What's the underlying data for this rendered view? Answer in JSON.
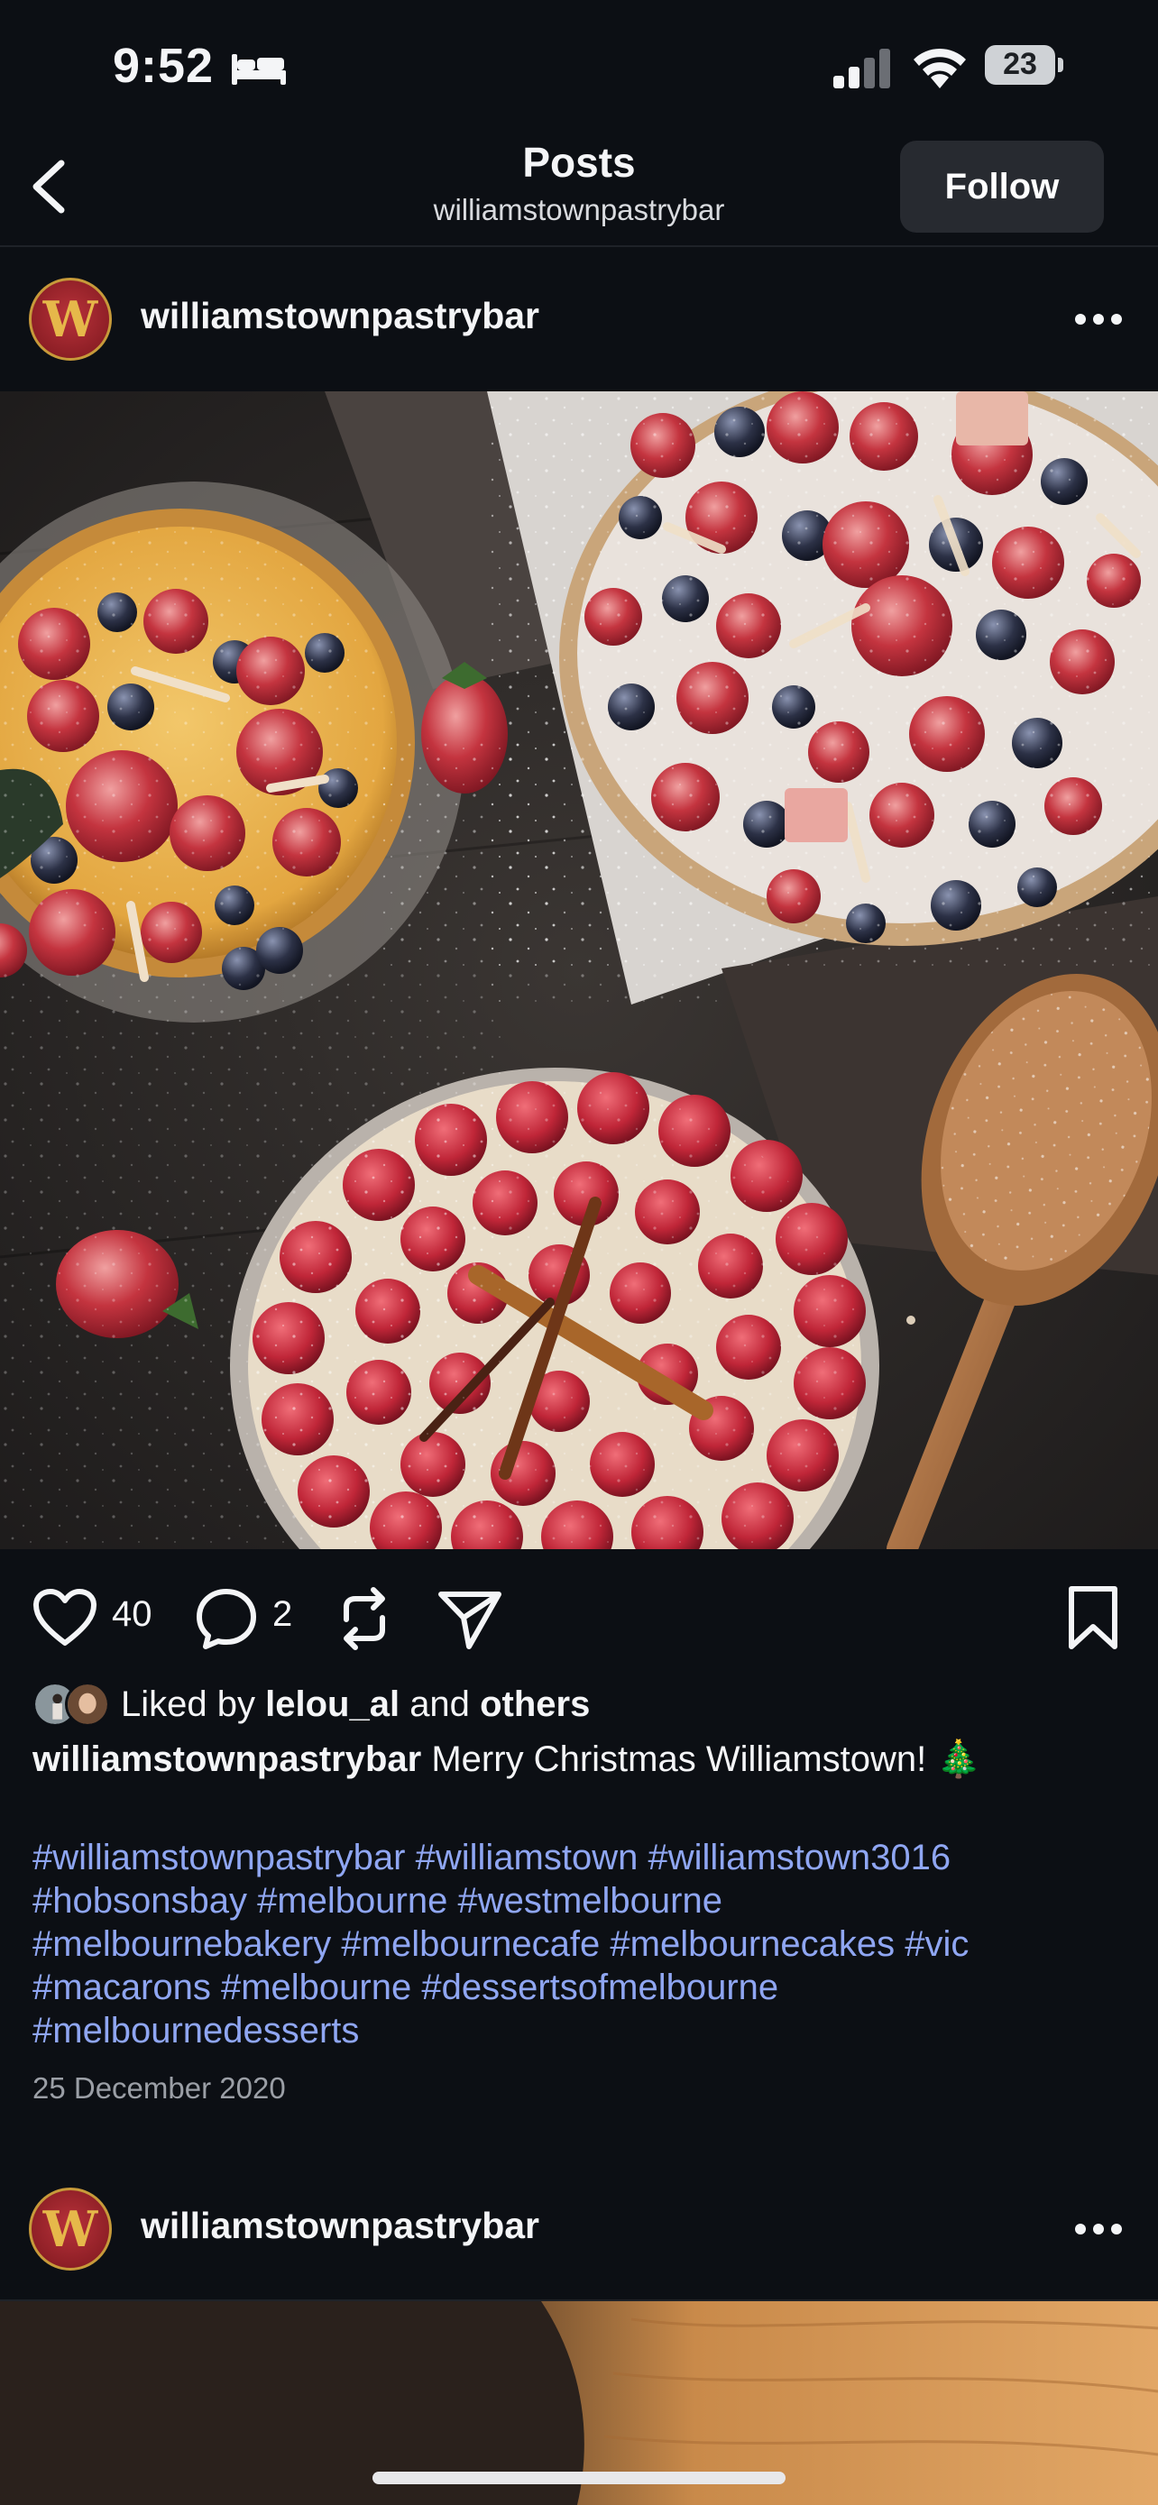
{
  "status_bar": {
    "time": "9:52",
    "battery": "23"
  },
  "header": {
    "title": "Posts",
    "subtitle": "williamstownpastrybar",
    "follow_label": "Follow"
  },
  "post": {
    "username": "williamstownpastrybar",
    "avatar_letter": "W",
    "likes": "40",
    "comments": "2",
    "liked_by_prefix": "Liked by",
    "liked_by_user": "lelou_al",
    "liked_by_and": "and",
    "liked_by_others": "others",
    "caption_user": "williamstownpastrybar",
    "caption_text": "Merry Christmas Williamstown! 🎄",
    "hashtag_lines": [
      "#williamstownpastrybar #williamstown #williamstown3016",
      "#hobsonsbay #melbourne #westmelbourne",
      "#melbournebakery #melbournecafe #melbournecakes #vic",
      "#macarons #melbourne #dessertsofmelbourne",
      "#melbournedesserts"
    ],
    "date": "25 December 2020"
  },
  "next_post": {
    "username": "williamstownpastrybar",
    "avatar_letter": "W"
  },
  "colors": {
    "background": "#0c0f14",
    "hashtag": "#8fa6f2",
    "follow_button": "#272a30",
    "avatar_red": "#8e1f26",
    "avatar_gold": "#c79a3a"
  },
  "icons": [
    "bed-icon",
    "signal-icon",
    "wifi-icon",
    "back-icon",
    "more-icon",
    "heart-icon",
    "comment-icon",
    "repost-icon",
    "share-icon",
    "bookmark-icon"
  ]
}
